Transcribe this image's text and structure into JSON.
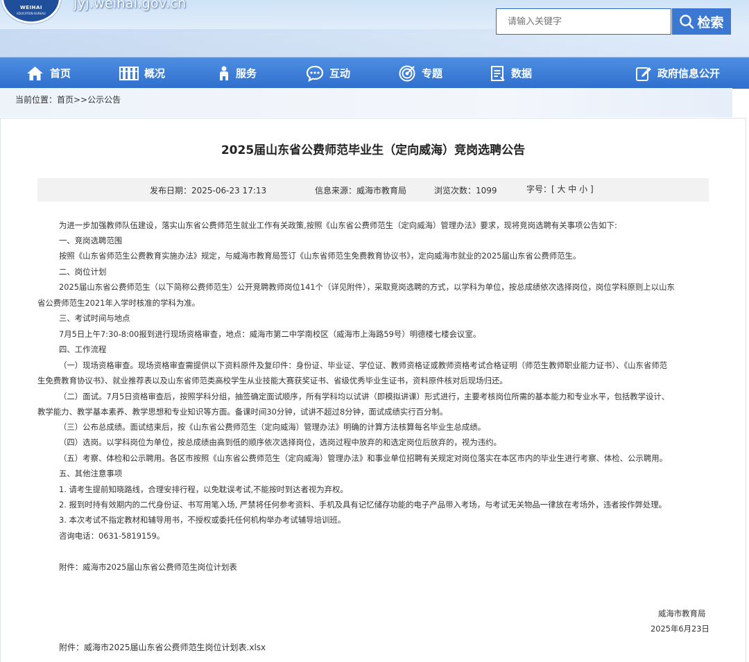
{
  "site": {
    "logo_text": "WEIHAI",
    "logo_subtext": "EDUCATION BUREAU",
    "domain": "jyj.weihai.gov.cn"
  },
  "search": {
    "placeholder": "请输入关键字",
    "button_label": "检索"
  },
  "nav": [
    {
      "label": "首页",
      "icon": "home-icon"
    },
    {
      "label": "概况",
      "icon": "books-icon"
    },
    {
      "label": "服务",
      "icon": "person-icon"
    },
    {
      "label": "互动",
      "icon": "chat-icon"
    },
    {
      "label": "专题",
      "icon": "target-icon"
    },
    {
      "label": "数据",
      "icon": "document-icon"
    },
    {
      "label": "政府信息公开",
      "icon": "edit-icon"
    }
  ],
  "breadcrumb": {
    "text": "当前位置：首页>>公示公告"
  },
  "article": {
    "title": "2025届山东省公费师范毕业生（定向威海）竞岗选聘公告",
    "meta": {
      "date": "发布日期：2025-06-23 17:13",
      "source": "信息来源：威海市教育局",
      "views": "浏览次数：1099",
      "font_size": "字号：[ 大 中 小 ]"
    },
    "lines": [
      "为进一步加强教师队伍建设，落实山东省公费师范生就业工作有关政策,按照《山东省公费师范生（定向威海）管理办法》要求，现将竞岗选聘有关事项公告如下:",
      "一、竞岗选聘范围",
      "按照《山东省师范生公费教育实施办法》规定，与威海市教育局签订《山东省师范生免费教育协议书》，定向威海市就业的2025届山东省公费师范生。",
      "二、岗位计划",
      "2025届山东省公费师范生（以下简称公费师范生）公开竞聘教师岗位141个（详见附件），采取竞岗选聘的方式，以学科为单位，按总成绩依次选择岗位，岗位学科原则上以山东",
      "省公费师范生2021年入学时核准的学科为准。",
      "三、考试时间与地点",
      "7月5日上午7:30-8:00报到进行现场资格审查，地点：威海市第二中学南校区（威海市上海路59号）明德楼七楼会议室。",
      "四、工作流程",
      "（一）现场资格审查。现场资格审查需提供以下资料原件及复印件：身份证、毕业证、学位证、教师资格证或教师资格考试合格证明（师范生教师职业能力证书）、《山东省师范",
      "生免费教育协议书》、就业推荐表以及山东省师范类高校学生从业技能大赛获奖证书、省级优秀毕业生证书，资料原件核对后现场归还。",
      "（二）面试。7月5日资格审查后，按照学科分组，抽签确定面试顺序，所有学科均以试讲（即模拟讲课）形式进行，主要考核岗位所需的基本能力和专业水平，包括教学设计、",
      "教学能力、教学基本素养、教学思想和专业知识等方面。备课时间30分钟，试讲不超过8分钟，面试成绩实行百分制。",
      "（三）公布总成绩。面试结束后，按《山东省公费师范生（定向威海）管理办法》明确的计算方法核算每名毕业生总成绩。",
      "（四）选岗。以学科岗位为单位，按总成绩由高到低的顺序依次选择岗位，选岗过程中放弃的和选定岗位后放弃的，视为违约。",
      "（五）考察、体检和公示聘用。各区市按照《山东省公费师范生（定向威海）管理办法》和事业单位招聘有关规定对岗位落实在本区市内的毕业生进行考察、体检、公示聘用。",
      "五、其他注意事项",
      "1. 请考生提前知晓路线，合理安排行程，以免耽误考试,不能按时到达者视为弃权。",
      "2. 报到时持有效期内的二代身份证、书写用笔入场, 严禁将任何参考资料、手机及具有记忆储存功能的电子产品带入考场，与考试无关物品一律放在考场外，违者按作弊处理。",
      "3. 本次考试不指定教材和辅导用书，不授权或委托任何机构举办考试辅导培训班。",
      "咨询电话：0631-5819159。"
    ],
    "attachment_note": "附件：威海市2025届山东省公费师范生岗位计划表",
    "signature": "威海市教育局",
    "sign_date": "2025年6月23日",
    "attachment_file": "附件：威海市2025届山东省公费师范生岗位计划表.xlsx"
  }
}
